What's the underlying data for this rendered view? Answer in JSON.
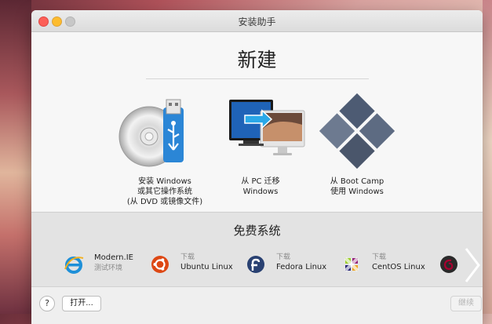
{
  "window": {
    "title": "安装助手"
  },
  "new_section": {
    "heading": "新建",
    "options": [
      {
        "line1": "安装 Windows",
        "line2": "或其它操作系统",
        "line3": "(从 DVD 或镜像文件)",
        "icon": "dvd-usb-icon"
      },
      {
        "line1": "从 PC 迁移",
        "line2": "Windows",
        "icon": "pc-to-mac-icon"
      },
      {
        "line1": "从 Boot Camp",
        "line2": "使用 Windows",
        "icon": "bootcamp-windows-icon"
      }
    ]
  },
  "free_section": {
    "heading": "免费系统",
    "items": [
      {
        "sub": "Modern.IE",
        "name": "测试环境",
        "icon": "internet-explorer-icon"
      },
      {
        "sub": "下载",
        "name": "Ubuntu Linux",
        "icon": "ubuntu-icon"
      },
      {
        "sub": "下载",
        "name": "Fedora Linux",
        "icon": "fedora-icon"
      },
      {
        "sub": "下载",
        "name": "CentOS Linux",
        "icon": "centos-icon"
      },
      {
        "icon": "debian-icon"
      }
    ]
  },
  "bottom": {
    "help": "?",
    "open": "打开...",
    "continue": "继续"
  },
  "colors": {
    "close": "#fc5f57",
    "minimize": "#fdbc2e",
    "ie_blue": "#1e90d8",
    "ubuntu_orange": "#dd4814",
    "fedora_blue": "#294172",
    "debian_red": "#a80030"
  }
}
